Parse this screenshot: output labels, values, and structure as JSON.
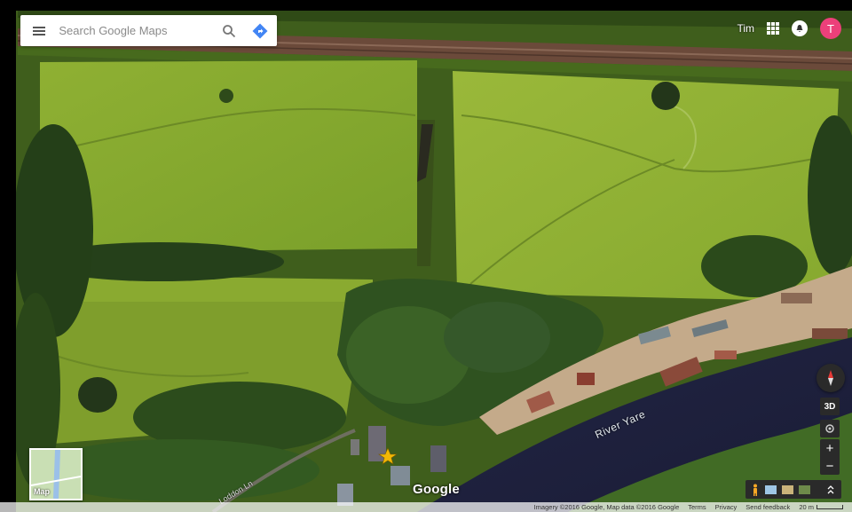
{
  "search": {
    "placeholder": "Search Google Maps"
  },
  "user": {
    "name": "Tim",
    "avatar_initial": "T",
    "avatar_color": "#ec407a"
  },
  "map": {
    "view": "satellite",
    "labels": {
      "river": "River Yare",
      "road": "Loddon Ln"
    },
    "brand": "Google"
  },
  "minimap": {
    "label": "Map"
  },
  "controls": {
    "three_d": "3D",
    "zoom_in": "+",
    "zoom_out": "−"
  },
  "footer": {
    "imagery": "Imagery ©2016 Google, Map data ©2016 Google",
    "terms": "Terms",
    "privacy": "Privacy",
    "feedback": "Send feedback",
    "scale": "20 m"
  },
  "icons": [
    "menu-icon",
    "search-icon",
    "directions-icon",
    "apps-icon",
    "notifications-icon",
    "compass-icon",
    "location-icon",
    "pegman-icon",
    "expand-icon"
  ]
}
